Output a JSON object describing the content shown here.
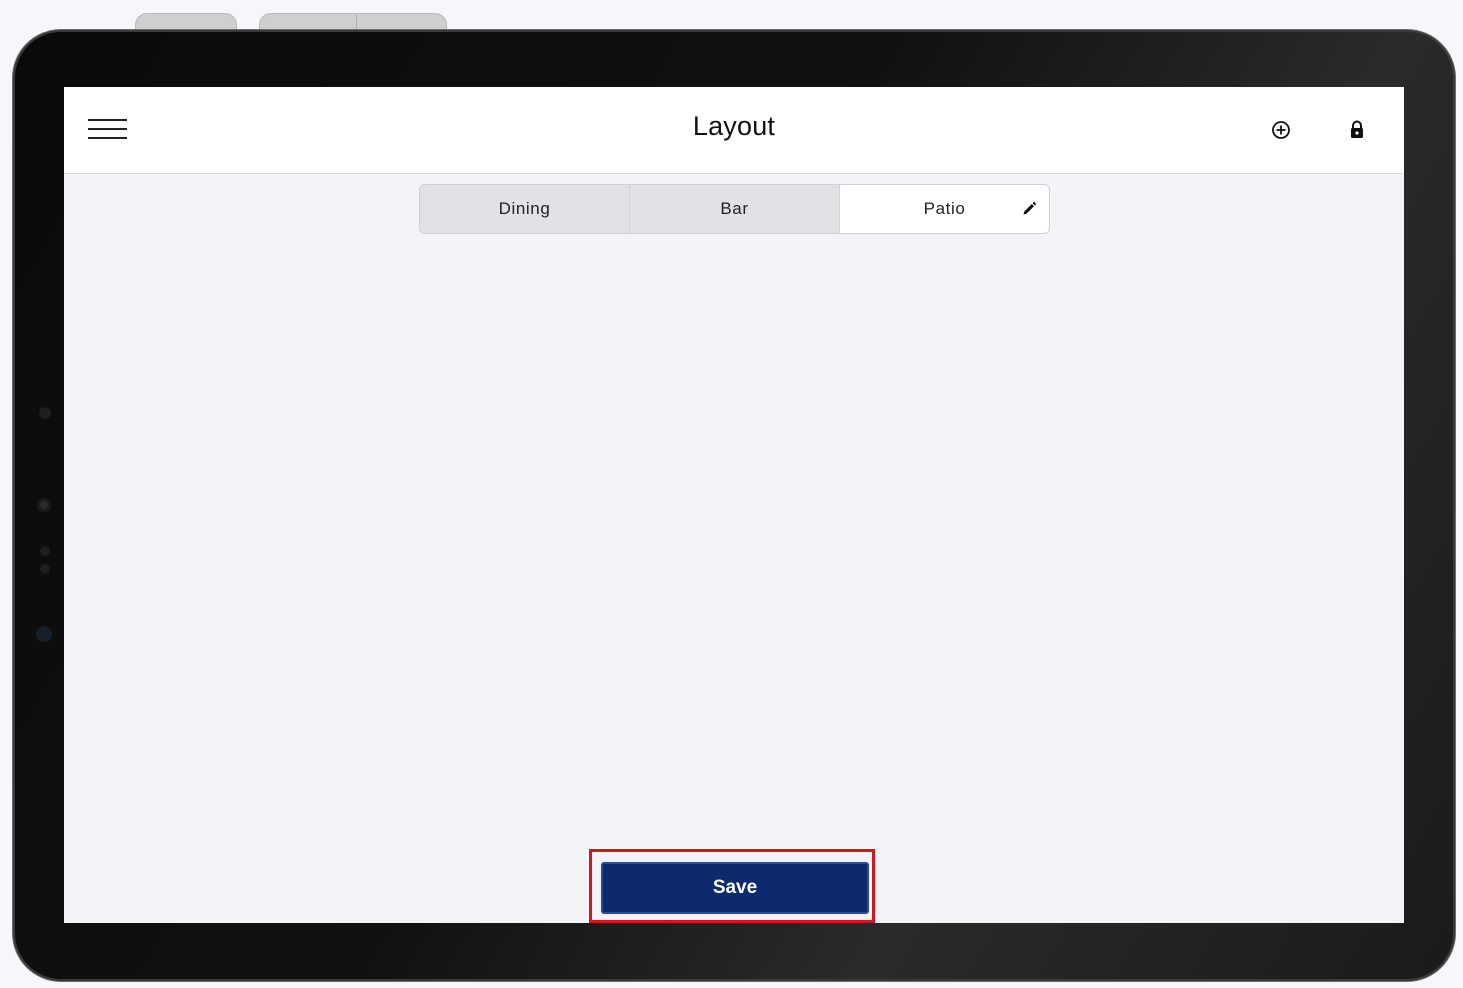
{
  "header": {
    "title": "Layout",
    "menu_icon": "hamburger-menu-icon",
    "add_icon": "add-circle-icon",
    "lock_icon": "lock-icon"
  },
  "tabs": [
    {
      "label": "Dining",
      "active": false
    },
    {
      "label": "Bar",
      "active": false
    },
    {
      "label": "Patio",
      "active": true,
      "icon": "edit-pencil-icon"
    }
  ],
  "footer": {
    "save_label": "Save"
  },
  "colors": {
    "primary_button": "#0d2a6e",
    "highlight_border": "#d4151f",
    "screen_background": "#f3f4f8",
    "topbar_background": "#ffffff"
  }
}
